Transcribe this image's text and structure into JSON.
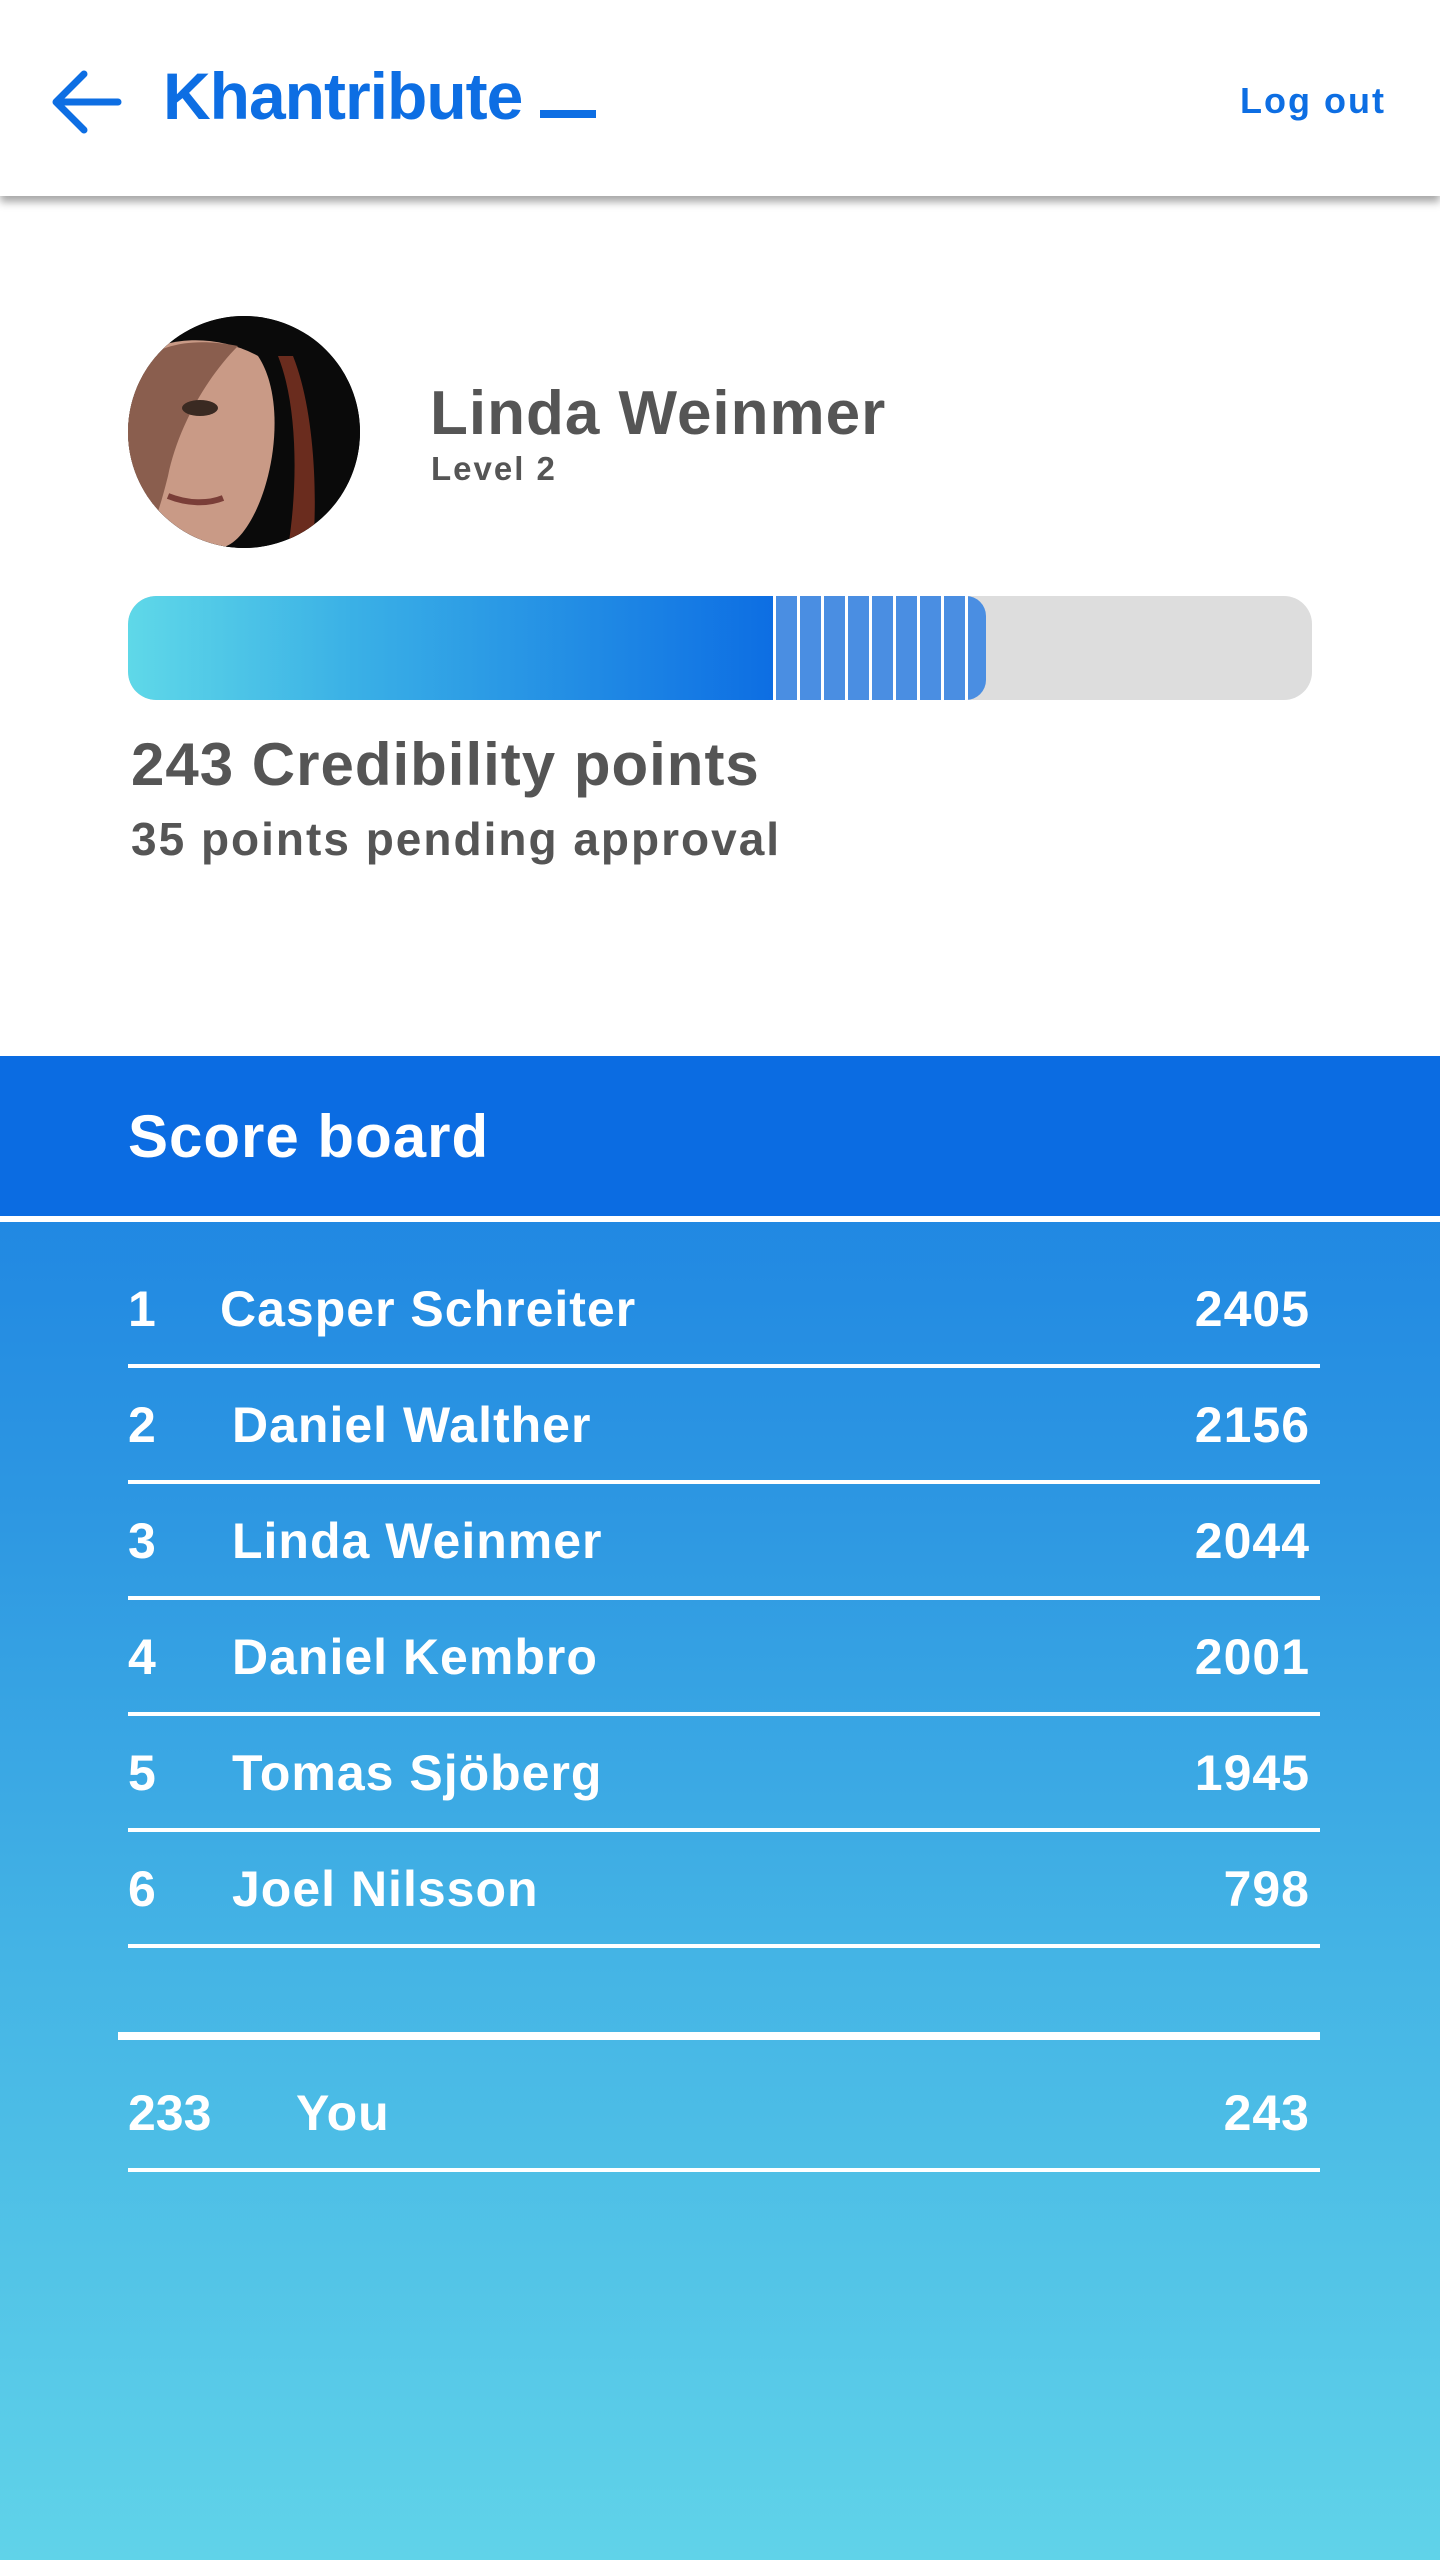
{
  "header": {
    "brand": "Khantribute",
    "logout_label": "Log out",
    "accent_color": "#0d6ee3"
  },
  "profile": {
    "name": "Linda Weinmer",
    "level": "Level 2",
    "points_text": "243 Credibility points",
    "pending_text": "35 points pending approval",
    "progress_fraction": 0.545,
    "pending_fraction": 0.18
  },
  "scoreboard": {
    "title": "Score board",
    "rows": [
      {
        "rank": "1",
        "name": "Casper Schreiter",
        "score": "2405"
      },
      {
        "rank": "2",
        "name": "Daniel Walther",
        "score": "2156"
      },
      {
        "rank": "3",
        "name": "Linda Weinmer",
        "score": "2044"
      },
      {
        "rank": "4",
        "name": "Daniel Kembro",
        "score": "2001"
      },
      {
        "rank": "5",
        "name": "Tomas Sjöberg",
        "score": "1945"
      },
      {
        "rank": "6",
        "name": "Joel Nilsson",
        "score": "798"
      }
    ],
    "you": {
      "rank": "233",
      "name": "You",
      "score": "243"
    }
  }
}
